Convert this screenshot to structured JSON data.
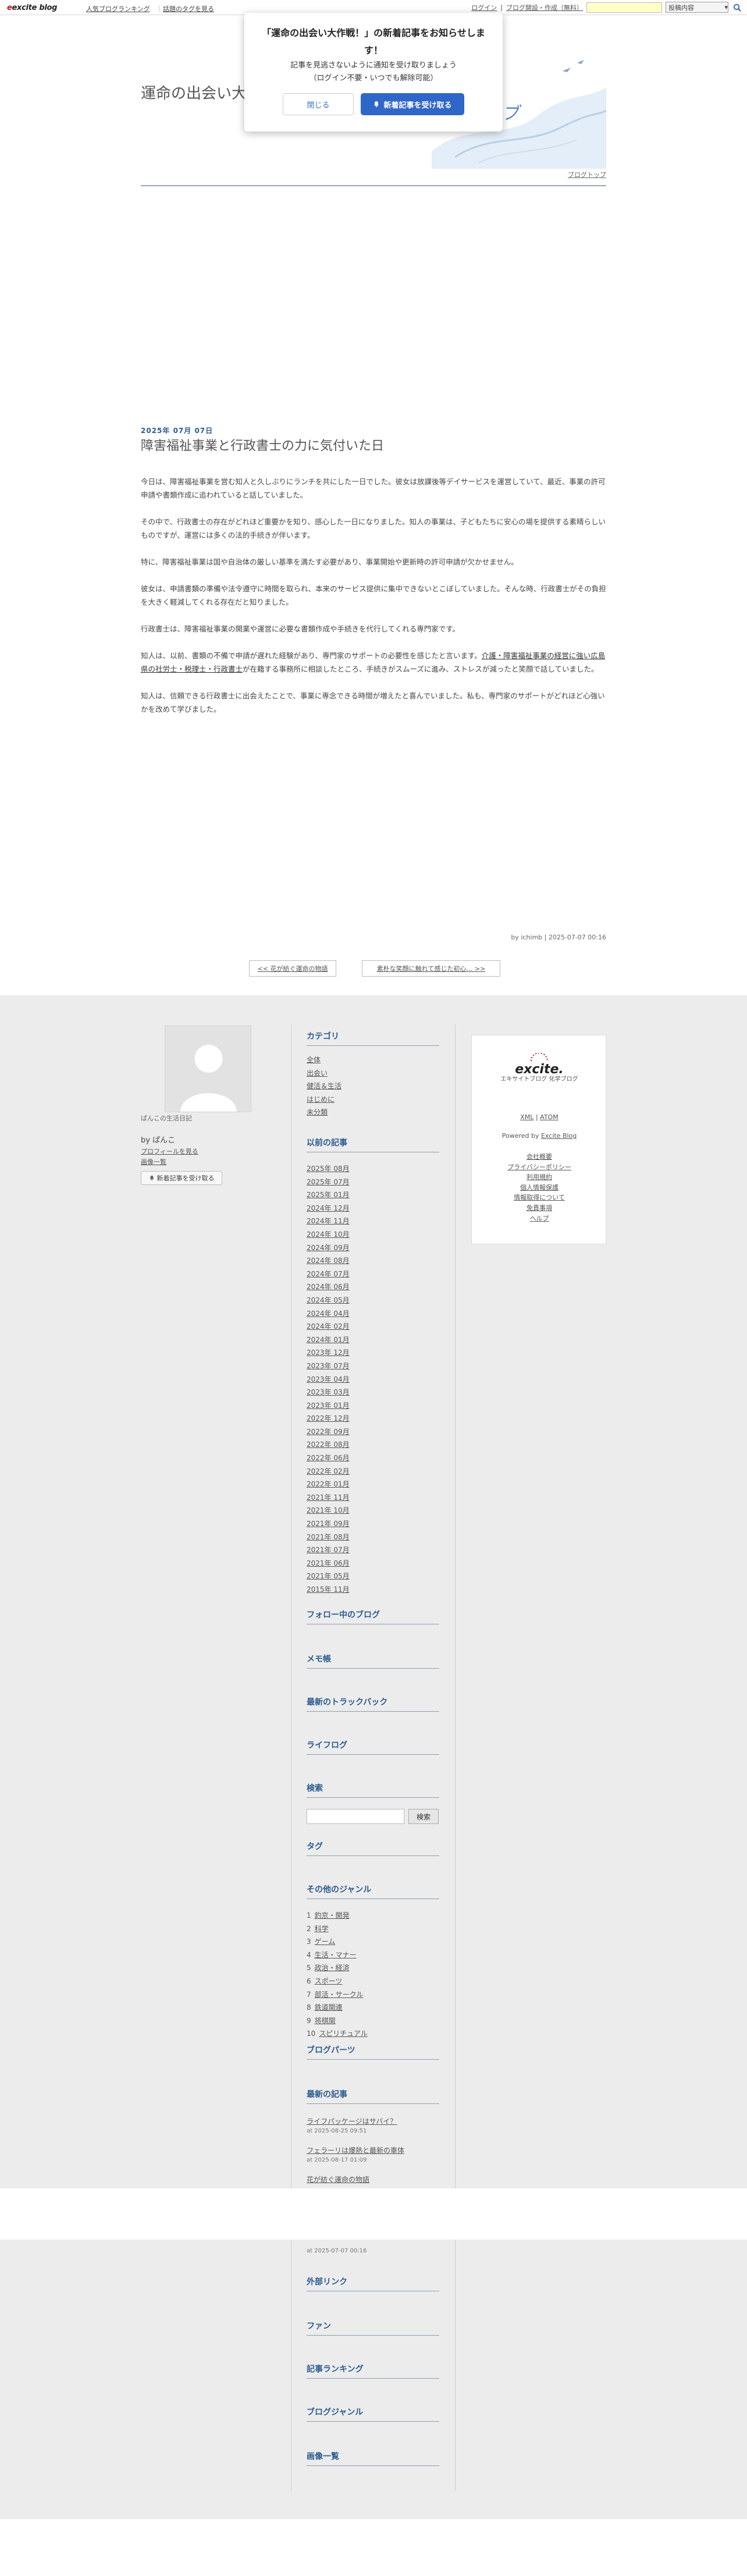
{
  "topbar": {
    "logo": "excite blog",
    "ranking_link": "人気ブログランキング",
    "sep": "｜",
    "hot_tag_link": "話題のタグを見る",
    "login": "ログイン",
    "blog_open": "ブログ開設・作成（無料）",
    "select_value": "投稿内容"
  },
  "header": {
    "title": "運命の出会い大作",
    "title_tail": "ブ",
    "top_link": "ブログトップ"
  },
  "popup": {
    "title": "「運命の出会い大作戦！」の新着記事をお知らせします！",
    "desc1": "記事を見逃さないように通知を受け取りましょう",
    "desc2": "（ログイン不要・いつでも解除可能）",
    "close": "閉じる",
    "accept": "新着記事を受け取る"
  },
  "post": {
    "date": "2025年 07月 07日",
    "title": "障害福祉事業と行政書士の力に気付いた日",
    "paragraphs": [
      "今日は、障害福祉事業を営む知人と久しぶりにランチを共にした一日でした。彼女は放課後等デイサービスを運営していて、最近、事業の許可申請や書類作成に追われていると話していました。",
      "その中で、行政書士の存在がどれほど重要かを知り、感心した一日になりました。知人の事業は、子どもたちに安心の場を提供する素晴らしいものですが、運営には多くの法的手続きが伴います。",
      "特に、障害福祉事業は国や自治体の厳しい基準を満たす必要があり、事業開始や更新時の許可申請が欠かせません。",
      "彼女は、申請書類の準備や法令遵守に時間を取られ、本来のサービス提供に集中できないとこぼしていました。そんな時、行政書士がその負担を大きく軽減してくれる存在だと知りました。",
      "行政書士は、障害福祉事業の開業や運営に必要な書類作成や手続きを代行してくれる専門家です。"
    ],
    "p6_before": "知人は、以前、書類の不備で申請が遅れた経験があり、専門家のサポートの必要性を感じたと言います。",
    "p6_link": "介護・障害福祉事業の経営に強い広島県の社労士・税理士・行政書士",
    "p6_after": "が在籍する事務所に相談したところ、手続きがスムーズに進み、ストレスが減ったと笑顔で話していました。",
    "p7": "知人は、信頼できる行政書士に出会えたことで、事業に専念できる時間が増えたと喜んでいました。私も、専門家のサポートがどれほど心強いかを改めて学びました。",
    "footer_by": "by ichimb",
    "footer_sep": "|",
    "footer_time": "2025-07-07 00:16",
    "prev": "<< 花が紡ぐ運命の物語",
    "next": "素朴な笑顔に触れて感じた初心… >>"
  },
  "profile": {
    "caption": "ぱんこの生活日記",
    "by": "by ぱんこ",
    "profile_link": "プロフィールを見る",
    "image_list": "画像一覧",
    "subscribe": "新着記事を受け取る"
  },
  "sidebar": {
    "category_h": "カテゴリ",
    "categories": [
      "全体",
      "出会い",
      "健活＆生活",
      "はじめに",
      "未分類"
    ],
    "archive_h": "以前の記事",
    "archives": [
      "2025年 08月",
      "2025年 07月",
      "2025年 01月",
      "2024年 12月",
      "2024年 11月",
      "2024年 10月",
      "2024年 09月",
      "2024年 08月",
      "2024年 07月",
      "2024年 06月",
      "2024年 05月",
      "2024年 04月",
      "2024年 02月",
      "2024年 01月",
      "2023年 12月",
      "2023年 07月",
      "2023年 04月",
      "2023年 03月",
      "2023年 01月",
      "2022年 12月",
      "2022年 09月",
      "2022年 08月",
      "2022年 06月",
      "2022年 02月",
      "2022年 01月",
      "2021年 11月",
      "2021年 10月",
      "2021年 09月",
      "2021年 08月",
      "2021年 07月",
      "2021年 06月",
      "2021年 05月",
      "2015年 11月"
    ],
    "follow_h": "フォロー中のブログ",
    "memo_h": "メモ帳",
    "trackback_h": "最新のトラックバック",
    "lifelog_h": "ライフログ",
    "search_h": "検索",
    "search_btn": "検索",
    "tag_h": "タグ",
    "genre_h": "その他のジャンル",
    "genres": [
      {
        "num": "1",
        "label": "釣京・開発"
      },
      {
        "num": "2",
        "label": "科学"
      },
      {
        "num": "3",
        "label": "ゲーム"
      },
      {
        "num": "4",
        "label": "生活・マナー"
      },
      {
        "num": "5",
        "label": "政治・経済"
      },
      {
        "num": "6",
        "label": "スポーツ"
      },
      {
        "num": "7",
        "label": "部活・サークル"
      },
      {
        "num": "8",
        "label": "鉄道関連"
      },
      {
        "num": "9",
        "label": "将棋関"
      },
      {
        "num": "10",
        "label": "スピリチュアル"
      }
    ],
    "blogparts_h": "ブログパーツ",
    "recent_h": "最新の記事",
    "recent": [
      {
        "title": "ライフパッケージはサバイ？",
        "date": "at 2025-08-25 09:51"
      },
      {
        "title": "フェラーリは爆熱と最新の車体",
        "date": "at 2025-08-17 01:09"
      },
      {
        "title": "花が紡ぐ運命の物語",
        "date": ""
      }
    ],
    "recent_last_date": "at 2025-07-07 00:16",
    "external_h": "外部リンク",
    "fan_h": "ファン",
    "ranking_h": "記事ランキング",
    "genre2_h": "ブログジャンル",
    "images_h": "画像一覧"
  },
  "excite_box": {
    "logo": "excite.",
    "sub": "エキサイトブログ 化学ブログ",
    "xml": "XML",
    "sep": " | ",
    "atom": "ATOM",
    "powered_prefix": "Powered by ",
    "powered_link": "Excite Blog",
    "links": [
      "会社概要",
      "プライバシーポリシー",
      "利用規約",
      "個人情報保護",
      "情報取得について",
      "免責事項",
      "ヘルプ"
    ]
  }
}
